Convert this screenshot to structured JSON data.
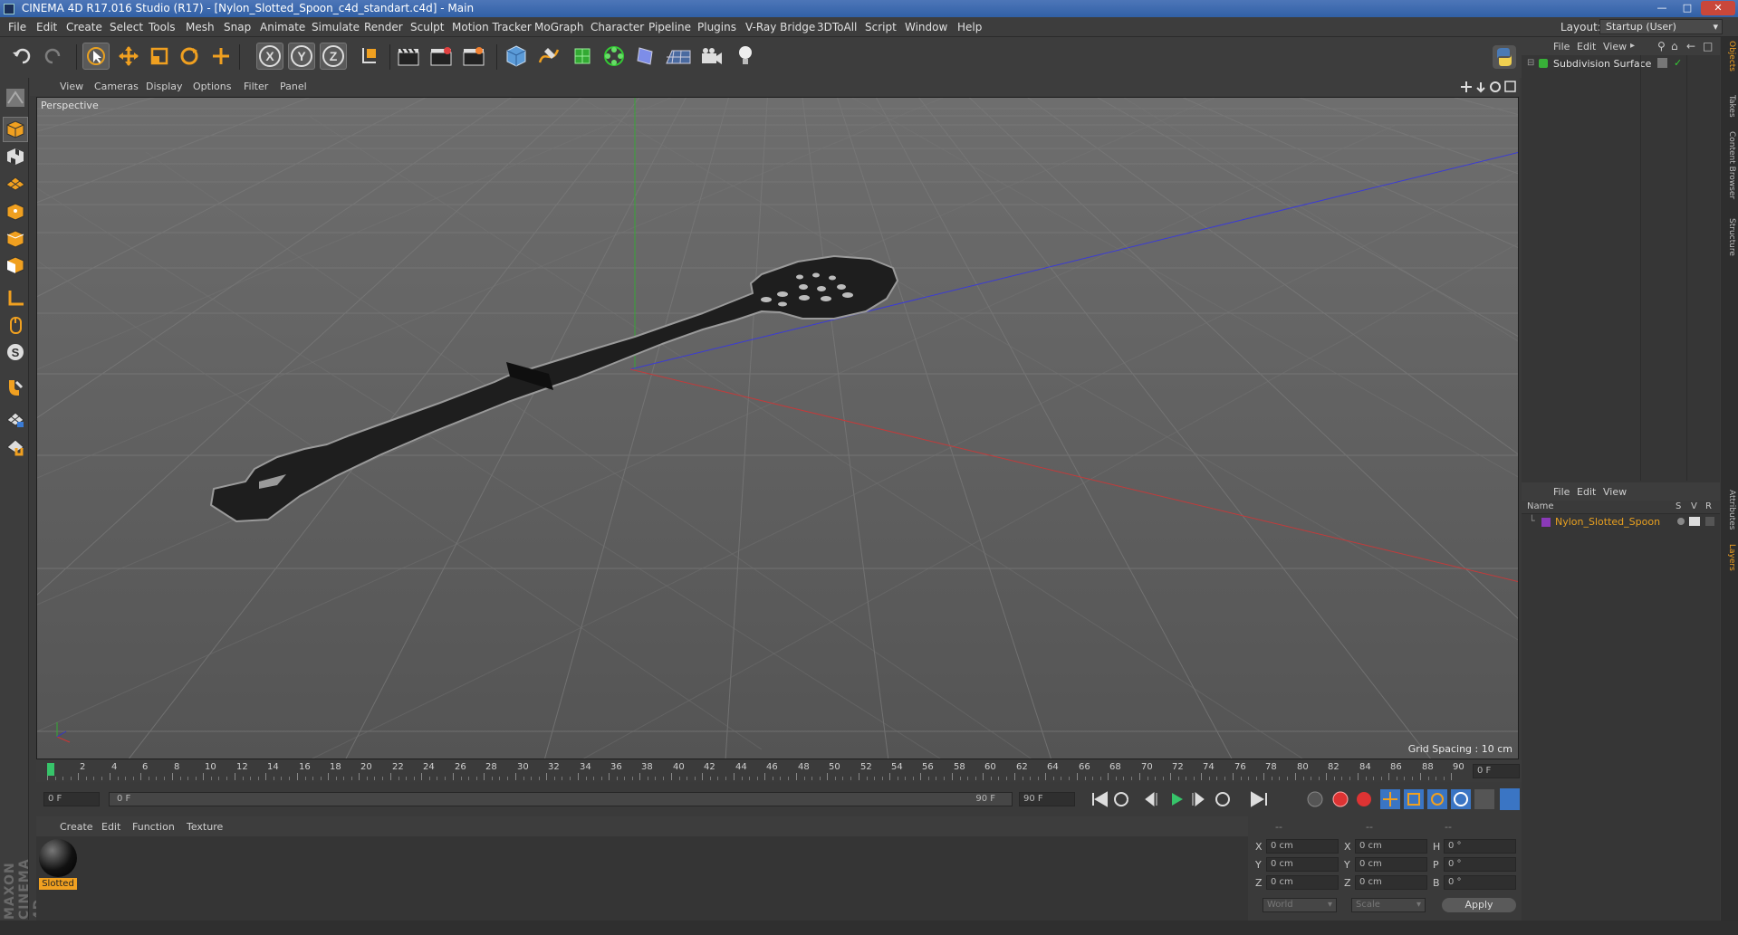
{
  "window": {
    "title": "CINEMA 4D R17.016 Studio (R17) - [Nylon_Slotted_Spoon_c4d_standart.c4d] - Main",
    "layout_label": "Layout:",
    "layout_value": "Startup (User)"
  },
  "menu": [
    "File",
    "Edit",
    "Create",
    "Select",
    "Tools",
    "Mesh",
    "Snap",
    "Animate",
    "Simulate",
    "Render",
    "Sculpt",
    "Motion Tracker",
    "MoGraph",
    "Character",
    "Pipeline",
    "Plugins",
    "V-Ray Bridge",
    "3DToAll",
    "Script",
    "Window",
    "Help"
  ],
  "toolbar": {
    "axis_x": "X",
    "axis_y": "Y",
    "axis_z": "Z"
  },
  "viewport": {
    "menu": [
      "View",
      "Cameras",
      "Display",
      "Options",
      "Filter",
      "Panel"
    ],
    "label": "Perspective",
    "grid_spacing": "Grid Spacing : 10 cm"
  },
  "timeline": {
    "ticks": [
      "0",
      "2",
      "4",
      "6",
      "8",
      "10",
      "12",
      "14",
      "16",
      "18",
      "20",
      "22",
      "24",
      "26",
      "28",
      "30",
      "32",
      "34",
      "36",
      "38",
      "40",
      "42",
      "44",
      "46",
      "48",
      "50",
      "52",
      "54",
      "56",
      "58",
      "60",
      "62",
      "64",
      "66",
      "68",
      "70",
      "72",
      "74",
      "76",
      "78",
      "80",
      "82",
      "84",
      "86",
      "88",
      "90"
    ],
    "current_frame_field": "0 F",
    "start_field": "0 F",
    "range_start": "0 F",
    "range_end": "90 F",
    "end_field": "90 F"
  },
  "material_manager": {
    "menu": [
      "Create",
      "Edit",
      "Function",
      "Texture"
    ],
    "material_name": "Slotted"
  },
  "coordinates": {
    "header": [
      "--",
      "--",
      "--"
    ],
    "rows": [
      {
        "a": "X",
        "av": "0 cm",
        "b": "X",
        "bv": "0 cm",
        "c": "H",
        "cv": "0 °"
      },
      {
        "a": "Y",
        "av": "0 cm",
        "b": "Y",
        "bv": "0 cm",
        "c": "P",
        "cv": "0 °"
      },
      {
        "a": "Z",
        "av": "0 cm",
        "b": "Z",
        "bv": "0 cm",
        "c": "B",
        "cv": "0 °"
      }
    ],
    "world": "World",
    "scale": "Scale",
    "apply": "Apply"
  },
  "object_manager": {
    "menu": [
      "File",
      "Edit",
      "View"
    ],
    "item": "Subdivision Surface"
  },
  "layer_manager": {
    "menu": [
      "File",
      "Edit",
      "View"
    ],
    "col_name": "Name",
    "col_s": "S",
    "col_v": "V",
    "col_r": "R",
    "item": "Nylon_Slotted_Spoon"
  },
  "side_tabs": [
    "Objects",
    "Takes",
    "Content Browser",
    "Structure",
    "Attributes",
    "Layers"
  ],
  "brand": "MAXON CINEMA 4D",
  "colors": {
    "accent_orange": "#f0a020",
    "title_blue": "#3e69ad",
    "layer_name": "#e8a020"
  }
}
